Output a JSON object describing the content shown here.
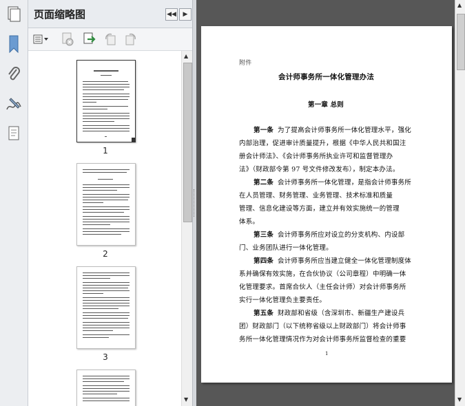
{
  "panel": {
    "title": "页面缩略图",
    "thumbnails": [
      {
        "label": "1"
      },
      {
        "label": "2"
      },
      {
        "label": "3"
      }
    ]
  },
  "document": {
    "attachment_label": "附件",
    "title": "会计师事务所一体化管理办法",
    "chapter": "第一章  总则",
    "article1": {
      "head": "第一条",
      "lines": [
        "为了提高会计师事务所一体化管理水平，强化",
        "内部治理，促进审计质量提升，根据《中华人民共和国注",
        "册会计师法》、《会计师事务所执业许可和监督管理办",
        "法》（财政部令第 97 号文件修改发布），制定本办法。"
      ]
    },
    "article2": {
      "head": "第二条",
      "lines": [
        "会计师事务所一体化管理，是指会计师事务所",
        "在人员管理、财务管理、业务管理、技术标准和质量",
        "管理、信息化建设等方面，建立并有效实施统一的管理",
        "体系。"
      ]
    },
    "article3": {
      "head": "第三条",
      "lines": [
        "会计师事务所应对设立的分支机构、内设部",
        "门、业务团队进行一体化管理。"
      ]
    },
    "article4": {
      "head": "第四条",
      "lines": [
        "会计师事务所应当建立健全一体化管理制度体",
        "系并确保有效实施，在合伙协议（公司章程）中明确一体",
        "化管理要求。首席合伙人（主任会计师）对会计师事务所",
        "实行一体化管理负主要责任。"
      ]
    },
    "article5": {
      "head": "第五条",
      "lines": [
        "财政部和省级（含深圳市、新疆生产建设兵",
        "团）财政部门（以下统称省级以上财政部门）将会计师事",
        "务所一体化管理情况作为对会计师事务所监督检查的重要"
      ]
    },
    "page_number": "1"
  },
  "icons": {
    "sidebar": [
      "bookmark-icon",
      "attachment-icon",
      "signature-icon",
      "layers-icon"
    ],
    "toolbar": [
      "options-icon",
      "delete-page-icon",
      "insert-page-icon",
      "rotate-ccw-icon",
      "rotate-cw-icon"
    ]
  }
}
